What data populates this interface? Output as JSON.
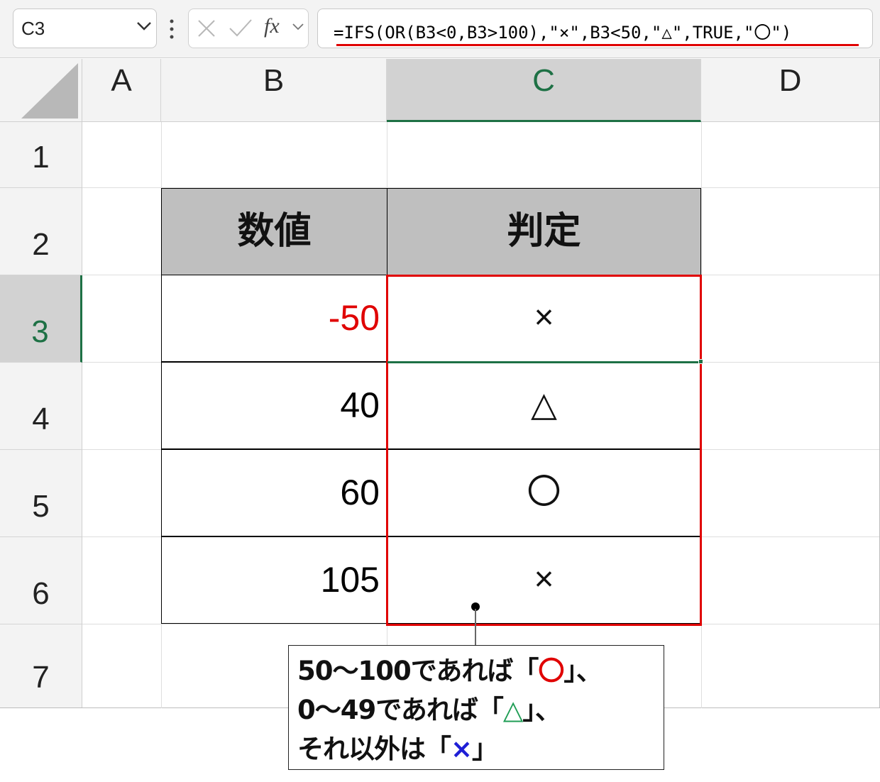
{
  "formula_bar": {
    "name_box": "C3",
    "formula": "=IFS(OR(B3<0,B3>100),\"×\",B3<50,\"△\",TRUE,\"〇\")"
  },
  "grid": {
    "columns": [
      "A",
      "B",
      "C",
      "D"
    ],
    "rows": [
      "1",
      "2",
      "3",
      "4",
      "5",
      "6",
      "7"
    ],
    "active_column": "C",
    "active_row": "3"
  },
  "table": {
    "headers": {
      "value": "数値",
      "judgement": "判定"
    },
    "rows": [
      {
        "value": "-50",
        "judgement": "×"
      },
      {
        "value": "40",
        "judgement": "△"
      },
      {
        "value": "60",
        "judgement": "〇"
      },
      {
        "value": "105",
        "judgement": "×"
      }
    ]
  },
  "callout": {
    "line1": {
      "prefix": "50～100であれば「",
      "symbol": "〇",
      "suffix": "」、"
    },
    "line2": {
      "prefix": "0～49であれば「",
      "symbol": "△",
      "suffix": "」、"
    },
    "line3": {
      "prefix": "それ以外は「",
      "symbol": "×",
      "suffix": "」"
    }
  },
  "colors": {
    "negative_value": "#e00000",
    "highlight": "#e00000",
    "active": "#1e7145",
    "callout_circle": "#e00000",
    "callout_triangle": "#1f9d55",
    "callout_cross": "#1f1fd6"
  }
}
